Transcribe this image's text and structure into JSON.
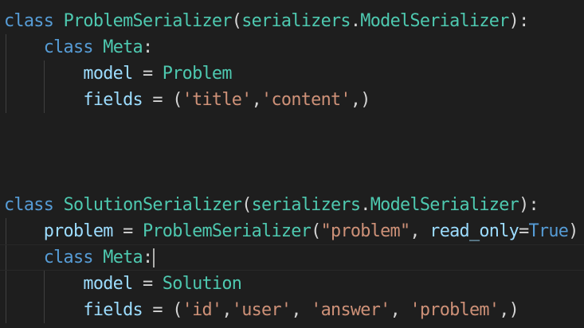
{
  "editor": {
    "colors": {
      "background": "#1e1e1e",
      "keyword": "#569cd6",
      "class_name": "#4ec9b0",
      "variable": "#9cdcfe",
      "string": "#ce9178",
      "punctuation": "#d4d4d4",
      "indent_guide": "#404040"
    },
    "lines": [
      {
        "tokens": [
          {
            "t": "class",
            "k": "kw"
          },
          {
            "t": " ",
            "k": "op"
          },
          {
            "t": "ProblemSerializer",
            "k": "cls"
          },
          {
            "t": "(",
            "k": "pn"
          },
          {
            "t": "serializers",
            "k": "cls"
          },
          {
            "t": ".",
            "k": "pn"
          },
          {
            "t": "ModelSerializer",
            "k": "cls"
          },
          {
            "t": "):",
            "k": "pn"
          }
        ]
      },
      {
        "tokens": [
          {
            "t": "    ",
            "k": "op"
          },
          {
            "t": "class",
            "k": "kw"
          },
          {
            "t": " ",
            "k": "op"
          },
          {
            "t": "Meta",
            "k": "cls"
          },
          {
            "t": ":",
            "k": "pn"
          }
        ]
      },
      {
        "tokens": [
          {
            "t": "        ",
            "k": "op"
          },
          {
            "t": "model",
            "k": "var"
          },
          {
            "t": " = ",
            "k": "op"
          },
          {
            "t": "Problem",
            "k": "cls"
          }
        ]
      },
      {
        "tokens": [
          {
            "t": "        ",
            "k": "op"
          },
          {
            "t": "fields",
            "k": "var"
          },
          {
            "t": " = (",
            "k": "op"
          },
          {
            "t": "'title'",
            "k": "str"
          },
          {
            "t": ",",
            "k": "pn"
          },
          {
            "t": "'content'",
            "k": "str"
          },
          {
            "t": ",)",
            "k": "pn"
          }
        ]
      },
      {
        "tokens": []
      },
      {
        "tokens": []
      },
      {
        "tokens": []
      },
      {
        "tokens": [
          {
            "t": "class",
            "k": "kw"
          },
          {
            "t": " ",
            "k": "op"
          },
          {
            "t": "SolutionSerializer",
            "k": "cls"
          },
          {
            "t": "(",
            "k": "pn"
          },
          {
            "t": "serializers",
            "k": "cls"
          },
          {
            "t": ".",
            "k": "pn"
          },
          {
            "t": "ModelSerializer",
            "k": "cls"
          },
          {
            "t": "):",
            "k": "pn"
          }
        ]
      },
      {
        "tokens": [
          {
            "t": "    ",
            "k": "op"
          },
          {
            "t": "problem",
            "k": "var"
          },
          {
            "t": " = ",
            "k": "op"
          },
          {
            "t": "ProblemSerializer",
            "k": "cls"
          },
          {
            "t": "(",
            "k": "pn"
          },
          {
            "t": "\"problem\"",
            "k": "str"
          },
          {
            "t": ", ",
            "k": "pn"
          },
          {
            "t": "read_only",
            "k": "var"
          },
          {
            "t": "=",
            "k": "op"
          },
          {
            "t": "True",
            "k": "kw"
          },
          {
            "t": ")",
            "k": "pn"
          }
        ]
      },
      {
        "current": true,
        "cursor": true,
        "tokens": [
          {
            "t": "    ",
            "k": "op"
          },
          {
            "t": "class",
            "k": "kw"
          },
          {
            "t": " ",
            "k": "op"
          },
          {
            "t": "Meta",
            "k": "cls"
          },
          {
            "t": ":",
            "k": "pn"
          }
        ]
      },
      {
        "tokens": [
          {
            "t": "        ",
            "k": "op"
          },
          {
            "t": "model",
            "k": "var"
          },
          {
            "t": " = ",
            "k": "op"
          },
          {
            "t": "Solution",
            "k": "cls"
          }
        ]
      },
      {
        "tokens": [
          {
            "t": "        ",
            "k": "op"
          },
          {
            "t": "fields",
            "k": "var"
          },
          {
            "t": " = (",
            "k": "op"
          },
          {
            "t": "'id'",
            "k": "str"
          },
          {
            "t": ",",
            "k": "pn"
          },
          {
            "t": "'user'",
            "k": "str"
          },
          {
            "t": ", ",
            "k": "pn"
          },
          {
            "t": "'answer'",
            "k": "str"
          },
          {
            "t": ", ",
            "k": "pn"
          },
          {
            "t": "'problem'",
            "k": "str"
          },
          {
            "t": ",)",
            "k": "pn"
          }
        ]
      }
    ]
  }
}
